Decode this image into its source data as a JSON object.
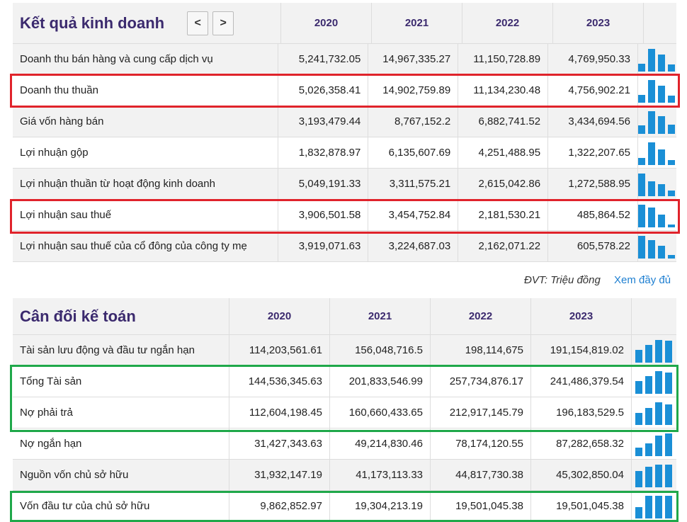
{
  "income": {
    "title": "Kết quả kinh doanh",
    "nav_prev": "<",
    "nav_next": ">",
    "years": [
      "2020",
      "2021",
      "2022",
      "2023"
    ],
    "rows": [
      {
        "label": "Doanh thu bán hàng và cung cấp dịch vụ",
        "values": [
          "5,241,732.05",
          "14,967,335.27",
          "11,150,728.89",
          "4,769,950.33"
        ],
        "trend": [
          5241732.05,
          14967335.27,
          11150728.89,
          4769950.33
        ]
      },
      {
        "label": "Doanh thu thuần",
        "values": [
          "5,026,358.41",
          "14,902,759.89",
          "11,134,230.48",
          "4,756,902.21"
        ],
        "trend": [
          5026358.41,
          14902759.89,
          11134230.48,
          4756902.21
        ]
      },
      {
        "label": "Giá vốn hàng bán",
        "values": [
          "3,193,479.44",
          "8,767,152.2",
          "6,882,741.52",
          "3,434,694.56"
        ],
        "trend": [
          3193479.44,
          8767152.2,
          6882741.52,
          3434694.56
        ]
      },
      {
        "label": "Lợi nhuận gộp",
        "values": [
          "1,832,878.97",
          "6,135,607.69",
          "4,251,488.95",
          "1,322,207.65"
        ],
        "trend": [
          1832878.97,
          6135607.69,
          4251488.95,
          1322207.65
        ]
      },
      {
        "label": "Lợi nhuận thuần từ hoạt động kinh doanh",
        "values": [
          "5,049,191.33",
          "3,311,575.21",
          "2,615,042.86",
          "1,272,588.95"
        ],
        "trend": [
          5049191.33,
          3311575.21,
          2615042.86,
          1272588.95
        ]
      },
      {
        "label": "Lợi nhuận sau thuế",
        "values": [
          "3,906,501.58",
          "3,454,752.84",
          "2,181,530.21",
          "485,864.52"
        ],
        "trend": [
          3906501.58,
          3454752.84,
          2181530.21,
          485864.52
        ]
      },
      {
        "label": "Lợi nhuận sau thuế của cổ đông của công ty mẹ",
        "values": [
          "3,919,071.63",
          "3,224,687.03",
          "2,162,071.22",
          "605,578.22"
        ],
        "trend": [
          3919071.63,
          3224687.03,
          2162071.22,
          605578.22
        ]
      }
    ]
  },
  "unit_note": "ĐVT: Triệu đồng",
  "more_link": "Xem đầy đủ",
  "balance": {
    "title": "Cân đối kế toán",
    "years": [
      "2020",
      "2021",
      "2022",
      "2023"
    ],
    "rows": [
      {
        "label": "Tài sản lưu động và đầu tư ngắn hạn",
        "values": [
          "114,203,561.61",
          "156,048,716.5",
          "198,114,675",
          "191,154,819.02"
        ],
        "trend": [
          114203561.61,
          156048716.5,
          198114675,
          191154819.02
        ]
      },
      {
        "label": "Tổng Tài sản",
        "values": [
          "144,536,345.63",
          "201,833,546.99",
          "257,734,876.17",
          "241,486,379.54"
        ],
        "trend": [
          144536345.63,
          201833546.99,
          257734876.17,
          241486379.54
        ]
      },
      {
        "label": "Nợ phải trả",
        "values": [
          "112,604,198.45",
          "160,660,433.65",
          "212,917,145.79",
          "196,183,529.5"
        ],
        "trend": [
          112604198.45,
          160660433.65,
          212917145.79,
          196183529.5
        ]
      },
      {
        "label": "Nợ ngắn hạn",
        "values": [
          "31,427,343.63",
          "49,214,830.46",
          "78,174,120.55",
          "87,282,658.32"
        ],
        "trend": [
          31427343.63,
          49214830.46,
          78174120.55,
          87282658.32
        ]
      },
      {
        "label": "Nguồn vốn chủ sở hữu",
        "values": [
          "31,932,147.19",
          "41,173,113.33",
          "44,817,730.38",
          "45,302,850.04"
        ],
        "trend": [
          31932147.19,
          41173113.33,
          44817730.38,
          45302850.04
        ]
      },
      {
        "label": "Vốn đầu tư của chủ sở hữu",
        "values": [
          "9,862,852.97",
          "19,304,213.19",
          "19,501,045.38",
          "19,501,045.38"
        ],
        "trend": [
          9862852.97,
          19304213.19,
          19501045.38,
          19501045.38
        ]
      }
    ]
  },
  "colors": {
    "bar": "#1a8fd6",
    "highlight_red": "#e0232b",
    "highlight_green": "#1fa84a",
    "heading": "#3b2a6e",
    "link": "#1e7fd1"
  }
}
